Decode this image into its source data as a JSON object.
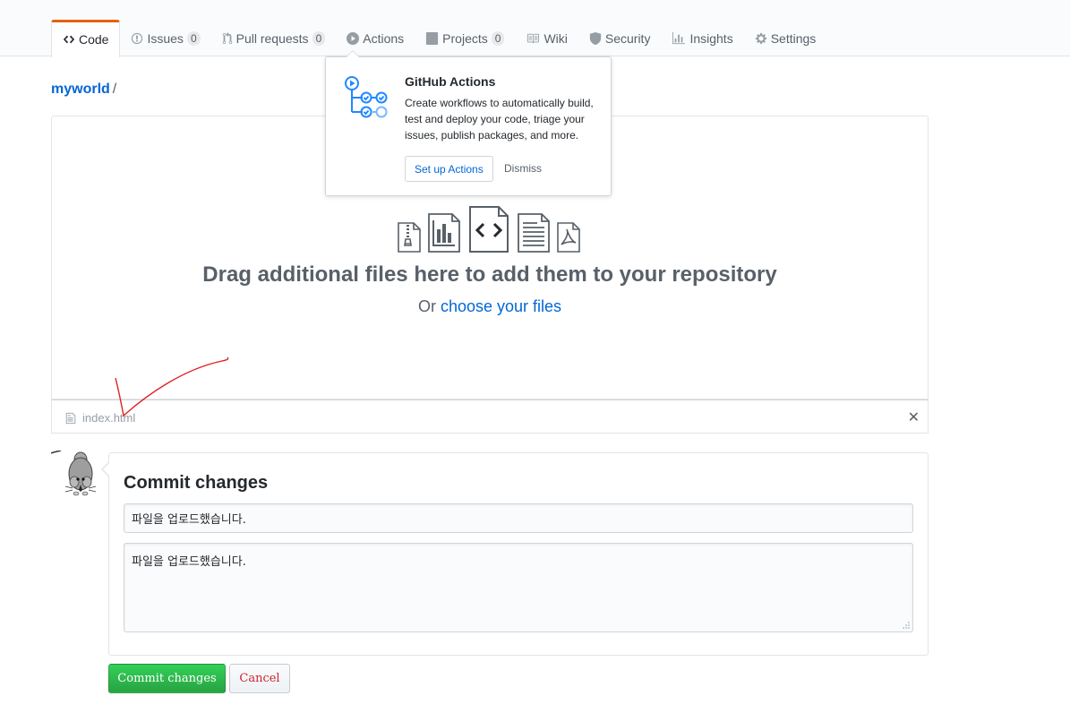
{
  "nav": {
    "tabs": [
      {
        "label": "Code",
        "icon": "code-icon",
        "selected": true
      },
      {
        "label": "Issues",
        "icon": "issue-opened-icon",
        "count": "0"
      },
      {
        "label": "Pull requests",
        "icon": "git-pull-request-icon",
        "count": "0"
      },
      {
        "label": "Actions",
        "icon": "play-icon"
      },
      {
        "label": "Projects",
        "icon": "project-icon",
        "count": "0"
      },
      {
        "label": "Wiki",
        "icon": "book-icon"
      },
      {
        "label": "Security",
        "icon": "shield-icon"
      },
      {
        "label": "Insights",
        "icon": "graph-icon"
      },
      {
        "label": "Settings",
        "icon": "gear-icon"
      }
    ],
    "accent_color": "#e36209"
  },
  "popover": {
    "title": "GitHub Actions",
    "description": "Create workflows to automatically build, test and deploy your code, triage your issues, publish packages, and more.",
    "setup_label": "Set up Actions",
    "dismiss_label": "Dismiss"
  },
  "breadcrumb": {
    "repo": "myworld",
    "separator": "/"
  },
  "upload": {
    "title": "Drag additional files here to add them to your repository",
    "sub_prefix": "Or",
    "sub_link": "choose your files",
    "file_types": [
      "zip-file-icon",
      "chart-file-icon",
      "code-file-icon",
      "text-file-icon",
      "pdf-file-icon"
    ]
  },
  "files": [
    {
      "name": "index.html"
    }
  ],
  "commit": {
    "title": "Commit changes",
    "summary_value": "파일을 업로드했습니다.",
    "description_value": "파일을 업로드했습니다.",
    "submit_label": "Commit changes",
    "cancel_label": "Cancel",
    "submit_color": "#28a745",
    "cancel_color": "#cb2431"
  }
}
